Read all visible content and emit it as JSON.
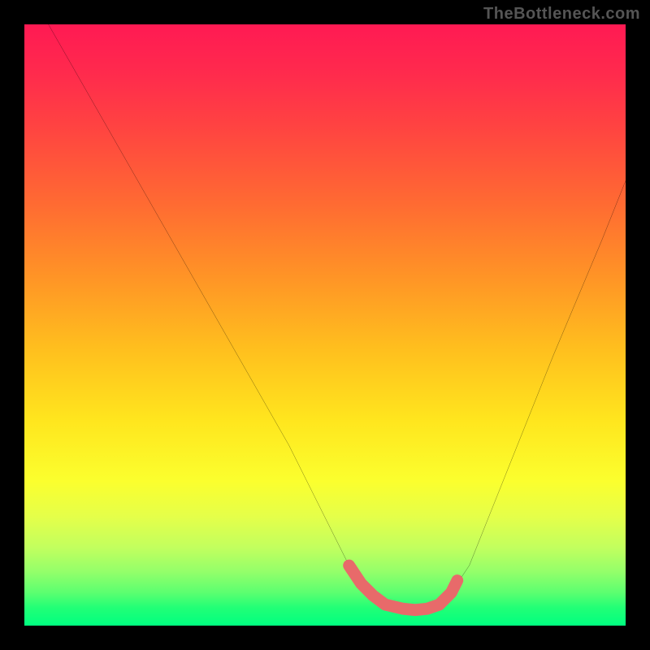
{
  "watermark": "TheBottleneck.com",
  "colors": {
    "background": "#000000",
    "curve": "#000000",
    "highlight": "#e86a6a",
    "gradient_top": "#ff1a53",
    "gradient_bottom": "#00ff80"
  },
  "chart_data": {
    "type": "line",
    "title": "",
    "xlabel": "",
    "ylabel": "",
    "xlim": [
      0,
      100
    ],
    "ylim": [
      0,
      100
    ],
    "series": [
      {
        "name": "curve",
        "x": [
          4,
          12,
          20,
          28,
          36,
          44,
          50,
          54,
          56,
          58,
          60,
          63,
          65,
          67,
          69,
          71,
          74,
          80,
          88,
          96,
          100
        ],
        "y": [
          100,
          86,
          72,
          58,
          44,
          30,
          18,
          10,
          7,
          5,
          3.5,
          2.8,
          2.6,
          2.8,
          3.5,
          5.5,
          10,
          25,
          45,
          64,
          74
        ]
      }
    ],
    "highlight_segment": {
      "name": "bottleneck-zone",
      "x": [
        54,
        56,
        58,
        60,
        63,
        65,
        67,
        69,
        71,
        72
      ],
      "y": [
        10,
        7,
        5,
        3.5,
        2.8,
        2.6,
        2.8,
        3.5,
        5.5,
        7.5
      ]
    }
  }
}
